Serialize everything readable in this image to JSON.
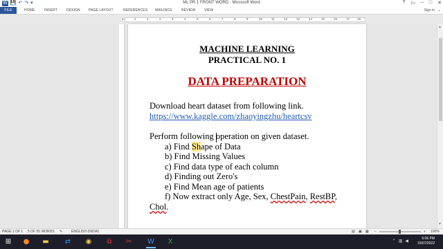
{
  "window": {
    "title": "ML PR 1 FRONT WORD - Microsoft Word",
    "controls": [
      "?",
      "▭",
      "–",
      "□",
      "✕"
    ],
    "qat": [
      "W",
      "💾",
      "↶",
      "↷",
      "▾"
    ]
  },
  "ribbon": {
    "file_tab": "FILE",
    "tabs": [
      "HOME",
      "INSERT",
      "DESIGN",
      "PAGE LAYOUT",
      "REFERENCES",
      "MAILINGS",
      "REVIEW",
      "VIEW"
    ],
    "sign_in": "Sign in"
  },
  "ruler": [
    "1",
    "2",
    "1",
    "2",
    "3",
    "4",
    "5",
    "6",
    "7",
    "8",
    "9",
    "10",
    "11",
    "12",
    "13",
    "14",
    "15",
    "16",
    "17",
    "18"
  ],
  "document": {
    "heading1": "MACHINE LEARNING",
    "heading2": "PRACTICAL NO. 1",
    "heading3": "DATA PREPARATION",
    "download_text": "Download heart dataset from following link.",
    "link": "https://www.kaggle.com/zhaoyingzhu/heartcsv",
    "perform_text": "Perform following operation on given dataset.",
    "items": {
      "a": "a) Find Shape of Data",
      "b": "b) Find Missing Values",
      "c": "c) Find data type of each column",
      "d": "d) Finding out Zero's",
      "e": "e) Find Mean age of patients",
      "f_prefix": "f) Now extract only Age, Sex, ",
      "f_chestpain": "ChestPain",
      "f_sep": ", ",
      "f_restbp": "RestBP",
      "f_comma": ",",
      "f_chol": "Chol",
      "f_end": "."
    }
  },
  "status": {
    "page": "PAGE 1 OF 1",
    "words": "5 OF 55 WORDS",
    "language": "ENGLISH (INDIA)",
    "zoom": "100%",
    "zoom_value": 100
  },
  "taskbar": {
    "time": "5:06 PM",
    "date": "15/07/2022"
  },
  "colors": {
    "word_blue": "#2b579a",
    "heading_red": "#c00000",
    "link_blue": "#1f5bb5"
  }
}
